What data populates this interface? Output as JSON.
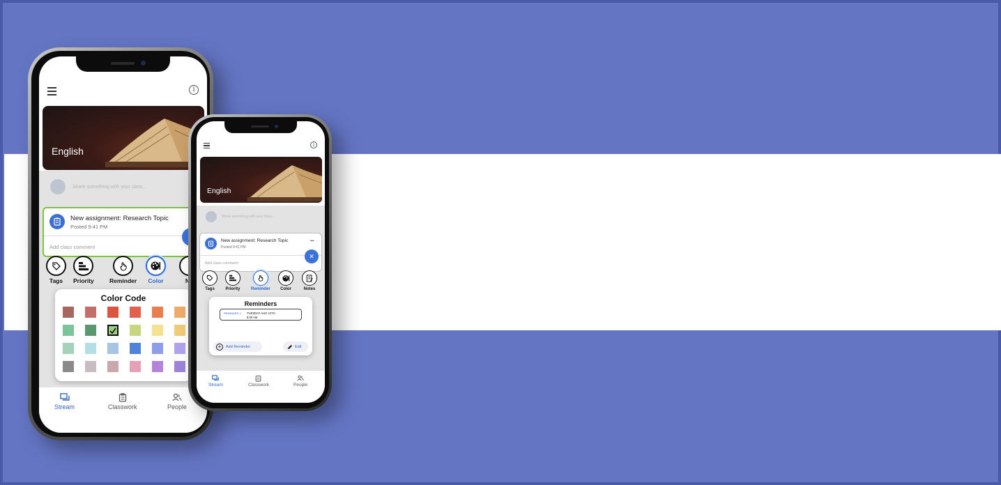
{
  "colors": {
    "background": "#6475c4",
    "band": "#ffffff",
    "accent": "#2f66c8",
    "card_border_green": "#7cc142"
  },
  "large_phone": {
    "menu_icon": "hamburger-icon",
    "info_icon": "info-icon",
    "info_glyph": "i",
    "banner_title": "English",
    "share_placeholder": "Share something with your class...",
    "post": {
      "title": "New assignment: Research Topic",
      "time": "Posted 9:41 PM",
      "comment_placeholder": "Add class comment"
    },
    "toolbar": [
      {
        "label": "Tags",
        "icon": "tag-icon",
        "active": false
      },
      {
        "label": "Priority",
        "icon": "priority-icon",
        "active": false
      },
      {
        "label": "Reminder",
        "icon": "reminder-hand-icon",
        "active": false
      },
      {
        "label": "Color",
        "icon": "palette-icon",
        "active": true
      },
      {
        "label": "No",
        "icon": "notes-icon",
        "active": false
      }
    ],
    "color_popup": {
      "title": "Color Code",
      "swatches": [
        [
          "#a7675e",
          "#c26e6b",
          "#dd5540",
          "#e2604c",
          "#ea7f4e",
          "#efad6b"
        ],
        [
          "#7cc59b",
          "#5a9870",
          "#9cd07e",
          "#c6d77f",
          "#f4e291",
          "#f1cc7a"
        ],
        [
          "#a4d2b8",
          "#b5dfe6",
          "#a6c5e2",
          "#4f83d8",
          "#8e9ee8",
          "#b2a4ec"
        ],
        [
          "#8a8a8a",
          "#c6bcc2",
          "#c9a7ad",
          "#e6a0b8",
          "#b583da",
          "#9e85d8"
        ]
      ],
      "checked_index": [
        1,
        2
      ]
    },
    "nav": [
      {
        "label": "Stream",
        "active": true
      },
      {
        "label": "Classwork",
        "active": false
      },
      {
        "label": "People",
        "active": false
      }
    ]
  },
  "small_phone": {
    "banner_title": "English",
    "share_placeholder": "Share something with your class...",
    "info_glyph": "i",
    "post": {
      "title": "New assignment: Research Topic",
      "time": "Posted 9:41 PM",
      "comment_placeholder": "Add class comment",
      "more_glyph": "•••",
      "close_glyph": "✕"
    },
    "toolbar": [
      {
        "label": "Tags",
        "icon": "tag-icon",
        "active": false
      },
      {
        "label": "Priority",
        "icon": "priority-icon",
        "active": false
      },
      {
        "label": "Reminder",
        "icon": "reminder-hand-icon",
        "active": true
      },
      {
        "label": "Color",
        "icon": "palette-icon",
        "active": false
      },
      {
        "label": "Notes",
        "icon": "notes-icon",
        "active": false
      }
    ],
    "reminder_popup": {
      "title": "Reminders",
      "reminder_label": "REMINDER 1:",
      "reminder_date": "TUESDAY AUG 12TH",
      "reminder_time": "8:00 AM",
      "add_label": "Add Reminder",
      "edit_label": "Edit"
    },
    "nav": [
      {
        "label": "Stream",
        "active": true
      },
      {
        "label": "Classwork",
        "active": false
      },
      {
        "label": "People",
        "active": false
      }
    ]
  }
}
